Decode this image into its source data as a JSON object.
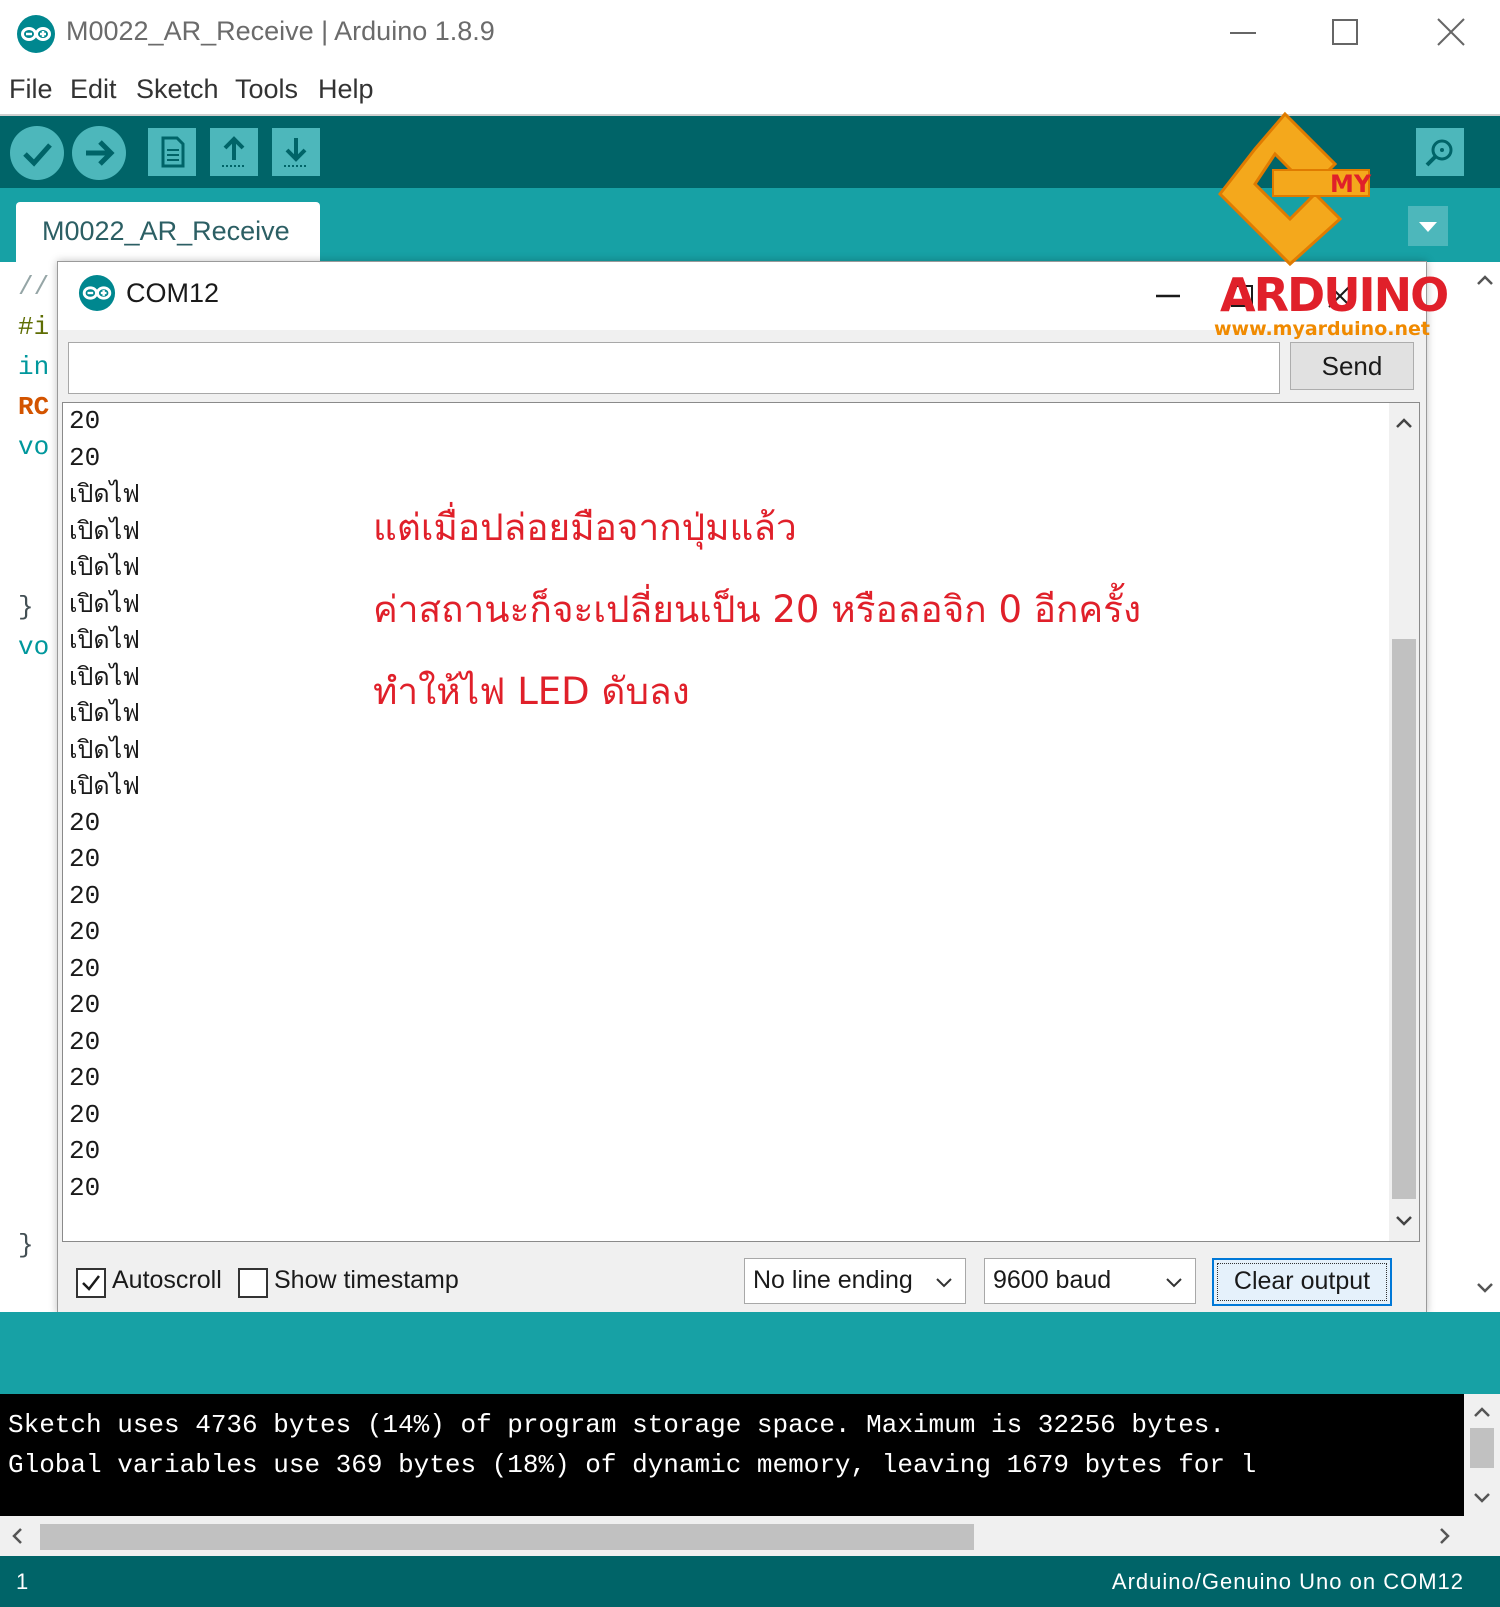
{
  "window": {
    "title": "M0022_AR_Receive | Arduino 1.8.9"
  },
  "menu": [
    "File",
    "Edit",
    "Sketch",
    "Tools",
    "Help"
  ],
  "toolbar": {
    "buttons": [
      "verify-icon",
      "upload-icon",
      "new-icon",
      "open-icon",
      "save-icon",
      "serial-monitor-icon"
    ]
  },
  "tab": {
    "label": "M0022_AR_Receive"
  },
  "editor": {
    "fragments": [
      "//",
      "#i",
      "in",
      "RC",
      "vo",
      "}",
      "vo",
      "}"
    ]
  },
  "serial_monitor": {
    "title": "COM12",
    "input_value": "",
    "send_label": "Send",
    "output": [
      "20",
      "20",
      "เปิดไฟ",
      "เปิดไฟ",
      "เปิดไฟ",
      "เปิดไฟ",
      "เปิดไฟ",
      "เปิดไฟ",
      "เปิดไฟ",
      "เปิดไฟ",
      "เปิดไฟ",
      "20",
      "20",
      "20",
      "20",
      "20",
      "20",
      "20",
      "20",
      "20",
      "20",
      "20"
    ],
    "annotation": [
      "แต่เมื่อปล่อยมือจากปุ่มแล้ว",
      "ค่าสถานะก็จะเปลี่ยนเป็น 20 หรือลอจิก 0 อีกครั้ง",
      "ทำให้ไฟ LED ดับลง"
    ],
    "autoscroll_label": "Autoscroll",
    "autoscroll_checked": true,
    "timestamp_label": "Show timestamp",
    "timestamp_checked": false,
    "line_ending": "No line ending",
    "baud": "9600 baud",
    "clear_label": "Clear output"
  },
  "console": {
    "lines": [
      "Sketch uses 4736 bytes (14%) of program storage space. Maximum is 32256 bytes.",
      "Global variables use 369 bytes (18%) of dynamic memory, leaving 1679 bytes for l"
    ]
  },
  "status": {
    "line": "1",
    "board": "Arduino/Genuino Uno on COM12"
  },
  "watermark": {
    "my": "MY",
    "brand": "ARDUINO",
    "url": "www.myarduino.net"
  },
  "colors": {
    "toolbar": "#006468",
    "tabstrip": "#17a1a5",
    "annotation": "#e0202a"
  }
}
